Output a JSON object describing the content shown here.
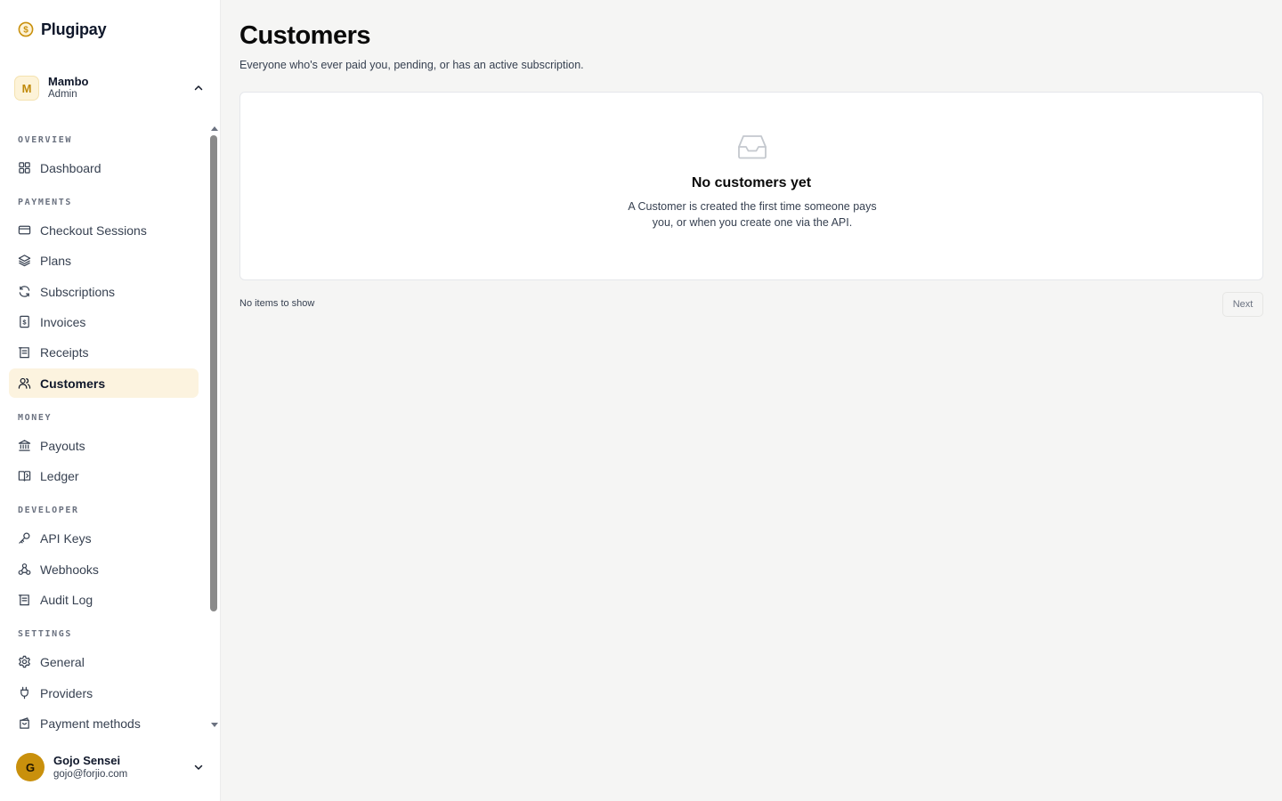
{
  "app": {
    "name": "Plugipay",
    "accent_color": "#c9900c"
  },
  "workspace": {
    "avatar_letter": "M",
    "name": "Mambo",
    "role": "Admin"
  },
  "sidebar": {
    "sections": [
      {
        "title": "OVERVIEW",
        "items": [
          {
            "label": "Dashboard",
            "icon": "grid-icon"
          }
        ]
      },
      {
        "title": "PAYMENTS",
        "items": [
          {
            "label": "Checkout Sessions",
            "icon": "credit-card-icon"
          },
          {
            "label": "Plans",
            "icon": "layers-icon"
          },
          {
            "label": "Subscriptions",
            "icon": "refresh-icon"
          },
          {
            "label": "Invoices",
            "icon": "dollar-document-icon"
          },
          {
            "label": "Receipts",
            "icon": "receipt-icon"
          },
          {
            "label": "Customers",
            "icon": "users-icon",
            "active": true
          }
        ]
      },
      {
        "title": "MONEY",
        "items": [
          {
            "label": "Payouts",
            "icon": "bank-icon"
          },
          {
            "label": "Ledger",
            "icon": "book-icon"
          }
        ]
      },
      {
        "title": "DEVELOPER",
        "items": [
          {
            "label": "API Keys",
            "icon": "key-icon"
          },
          {
            "label": "Webhooks",
            "icon": "webhook-icon"
          },
          {
            "label": "Audit Log",
            "icon": "log-icon"
          }
        ]
      },
      {
        "title": "SETTINGS",
        "items": [
          {
            "label": "General",
            "icon": "gear-icon"
          },
          {
            "label": "Providers",
            "icon": "plug-icon"
          },
          {
            "label": "Payment methods",
            "icon": "wallet-icon"
          }
        ]
      }
    ]
  },
  "user": {
    "avatar_letter": "G",
    "name": "Gojo Sensei",
    "email": "gojo@forjio.com"
  },
  "main": {
    "title": "Customers",
    "subtitle": "Everyone who's ever paid you, pending, or has an active subscription.",
    "empty_state": {
      "icon": "inbox-icon",
      "title": "No customers yet",
      "description": "A Customer is created the first time someone pays you, or when you create one via the API."
    },
    "pagination": {
      "status": "No items to show",
      "next_label": "Next"
    }
  }
}
